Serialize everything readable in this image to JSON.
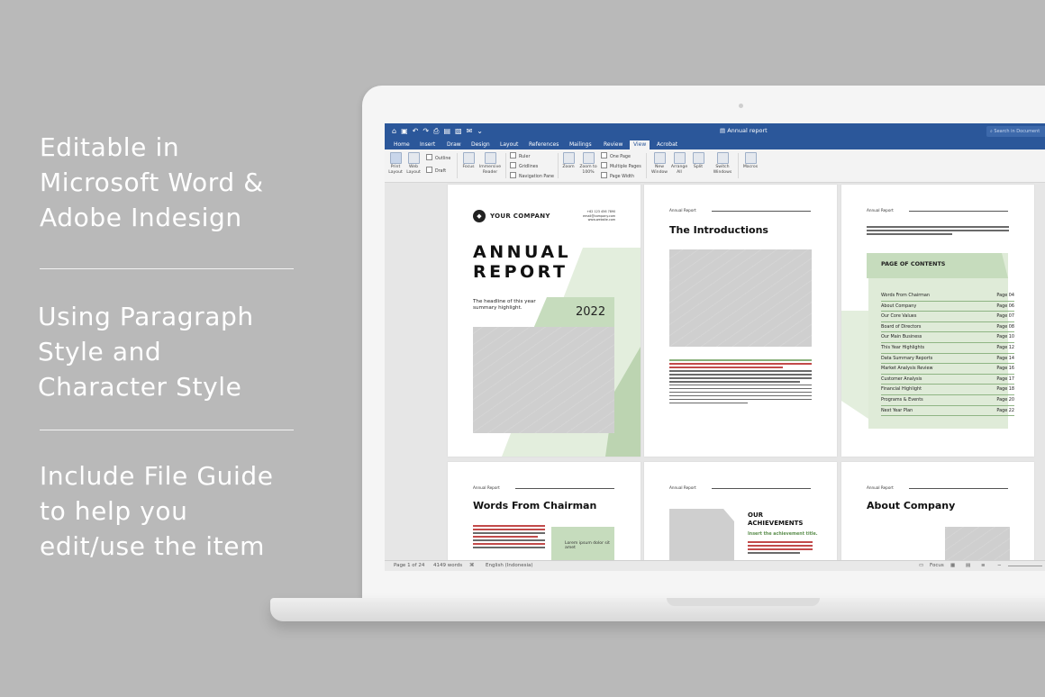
{
  "promo": {
    "feature1": [
      "Editable in",
      "Microsoft Word &",
      "Adobe Indesign"
    ],
    "feature2": [
      "Using Paragraph",
      "Style and",
      "Character Style"
    ],
    "feature3": [
      "Include File Guide",
      "to help you",
      "edit/use the item"
    ]
  },
  "word": {
    "doc_title": "Annual report",
    "search_placeholder": "Search in Document",
    "tabs": [
      "Home",
      "Insert",
      "Draw",
      "Design",
      "Layout",
      "References",
      "Mailings",
      "Review",
      "View",
      "Acrobat"
    ],
    "active_tab": "View",
    "ribbon": {
      "print_layout": "Print Layout",
      "web_layout": "Web Layout",
      "outline": "Outline",
      "draft": "Draft",
      "focus": "Focus",
      "immersive_reader": "Immersive Reader",
      "ruler": "Ruler",
      "gridlines": "Gridlines",
      "navigation_pane": "Navigation Pane",
      "zoom": "Zoom",
      "zoom_100": "Zoom to 100%",
      "one_page": "One Page",
      "multiple_pages": "Multiple Pages",
      "page_width": "Page Width",
      "new_window": "New Window",
      "arrange_all": "Arrange All",
      "split": "Split",
      "switch_windows": "Switch Windows",
      "macros": "Macros"
    },
    "status": {
      "page": "Page 1 of 24",
      "words": "4149 words",
      "language": "English (Indonesia)",
      "focus": "Focus"
    }
  },
  "pages": {
    "cover": {
      "company": "YOUR COMPANY",
      "title_line1": "ANNUAL",
      "title_line2": "REPORT",
      "headline": "The headline of this year summary highlight.",
      "year": "2022",
      "contact1": "+62 123 456 7890",
      "contact2": "email@company.com",
      "contact3": "www.website.com"
    },
    "intro": {
      "header": "Annual Report",
      "title": "The Introductions"
    },
    "toc": {
      "header": "Annual Report",
      "title": "PAGE OF CONTENTS",
      "rows": [
        {
          "label": "Words From Chairman",
          "page": "Page 04"
        },
        {
          "label": "About Company",
          "page": "Page 06"
        },
        {
          "label": "Our Core Values",
          "page": "Page 07"
        },
        {
          "label": "Board of Directors",
          "page": "Page 08"
        },
        {
          "label": "Our Main Business",
          "page": "Page 10"
        },
        {
          "label": "This Year Highlights",
          "page": "Page 12"
        },
        {
          "label": "Data Summary Reports",
          "page": "Page 14"
        },
        {
          "label": "Market Analysis Review",
          "page": "Page 16"
        },
        {
          "label": "Customer Analysis",
          "page": "Page 17"
        },
        {
          "label": "Financial Highlight",
          "page": "Page 18"
        },
        {
          "label": "Programs & Events",
          "page": "Page 20"
        },
        {
          "label": "Next Year Plan",
          "page": "Page 22"
        }
      ]
    },
    "chairman": {
      "header": "Annual Report",
      "title": "Words From Chairman",
      "quote": "Lorem ipsum dolor sit amet"
    },
    "achievements": {
      "header": "Annual Report",
      "title_line1": "OUR",
      "title_line2": "ACHIEVEMENTS",
      "subtitle": "Insert the achievement title."
    },
    "about": {
      "header": "Annual Report",
      "title": "About Company"
    }
  },
  "colors": {
    "word_blue": "#2b579a",
    "accent_green": "#c6dcbd"
  }
}
